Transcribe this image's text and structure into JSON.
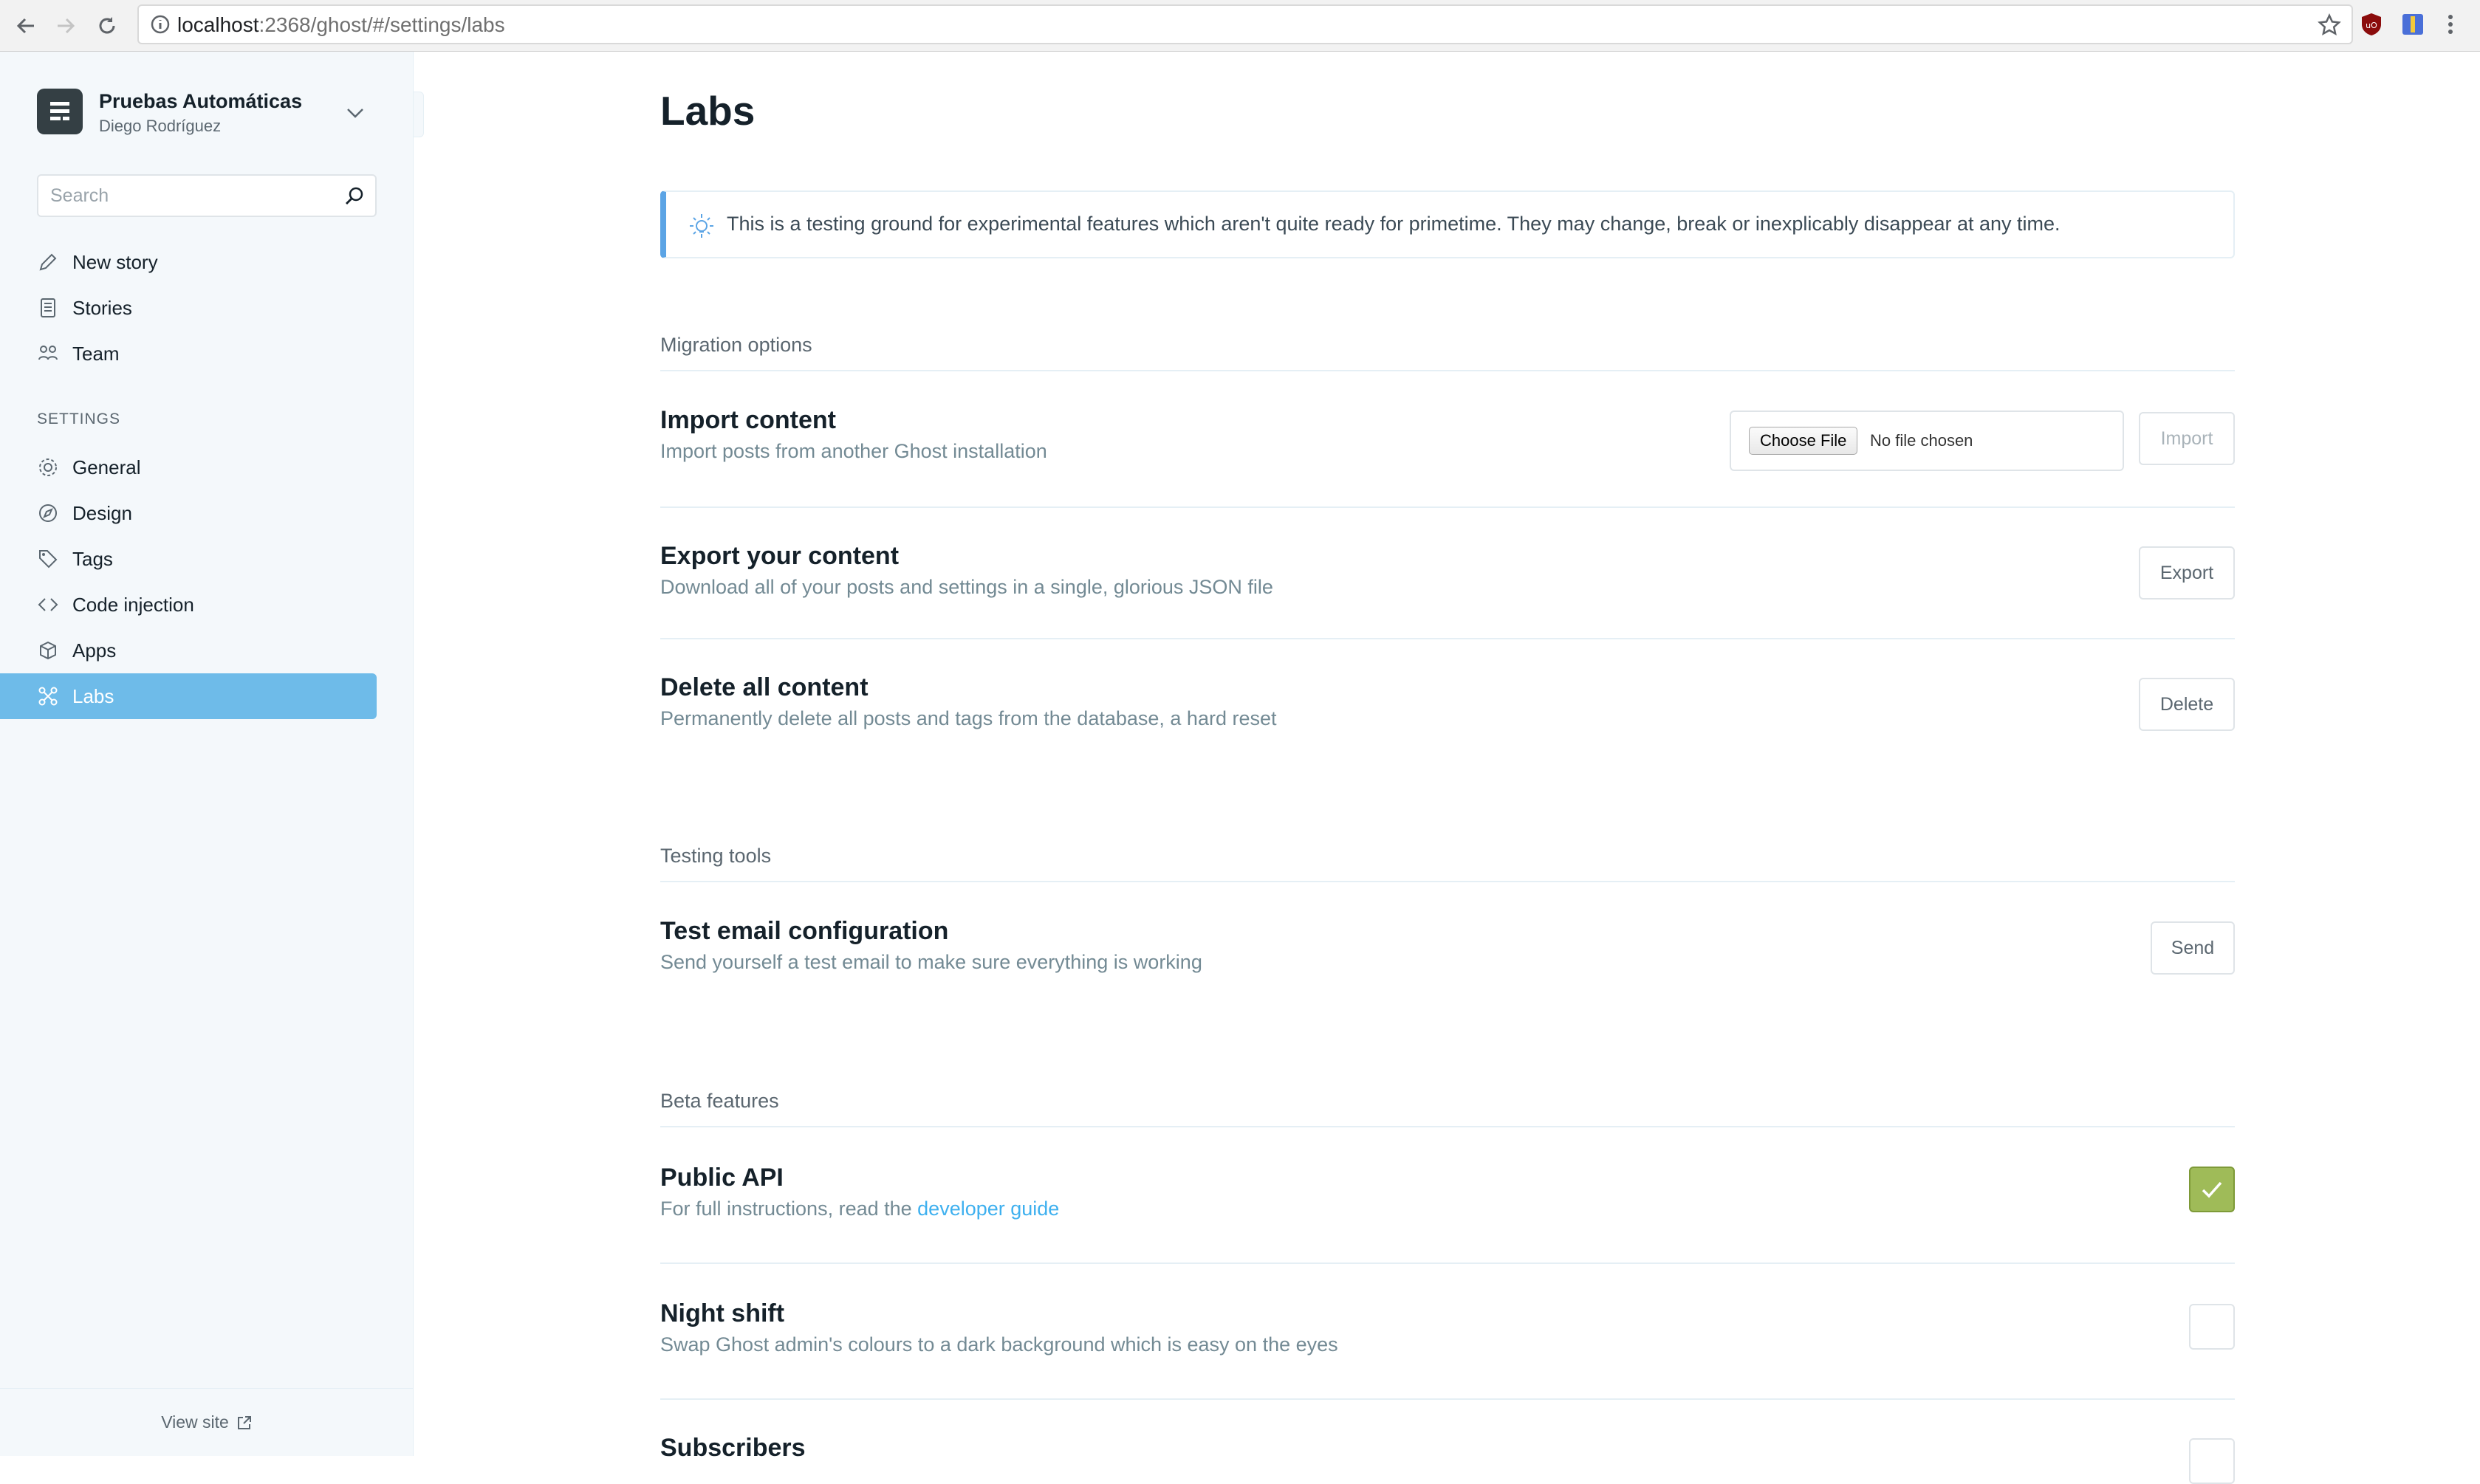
{
  "browser": {
    "url_host": "localhost",
    "url_path": ":2368/ghost/#/settings/labs"
  },
  "sidebar": {
    "blog_title": "Pruebas Automáticas",
    "user_name": "Diego Rodríguez",
    "search_placeholder": "Search",
    "nav": [
      {
        "label": "New story",
        "icon": "pencil-icon"
      },
      {
        "label": "Stories",
        "icon": "document-icon"
      },
      {
        "label": "Team",
        "icon": "team-icon"
      }
    ],
    "settings_heading": "SETTINGS",
    "settings": [
      {
        "label": "General",
        "icon": "gear-icon"
      },
      {
        "label": "Design",
        "icon": "compass-icon"
      },
      {
        "label": "Tags",
        "icon": "tag-icon"
      },
      {
        "label": "Code injection",
        "icon": "code-icon"
      },
      {
        "label": "Apps",
        "icon": "box-icon"
      },
      {
        "label": "Labs",
        "icon": "labs-icon",
        "active": true
      }
    ],
    "view_site": "View site",
    "active_color": "#6ebbe9"
  },
  "main": {
    "title": "Labs",
    "notice": "This is a testing ground for experimental features which aren't quite ready for primetime. They may change, break or inexplicably disappear at any time.",
    "sections": {
      "migration": {
        "heading": "Migration options",
        "import": {
          "title": "Import content",
          "desc": "Import posts from another Ghost installation",
          "choose_file": "Choose File",
          "file_status": "No file chosen",
          "button": "Import"
        },
        "export": {
          "title": "Export your content",
          "desc": "Download all of your posts and settings in a single, glorious JSON file",
          "button": "Export"
        },
        "delete": {
          "title": "Delete all content",
          "desc": "Permanently delete all posts and tags from the database, a hard reset",
          "button": "Delete"
        }
      },
      "testing": {
        "heading": "Testing tools",
        "email": {
          "title": "Test email configuration",
          "desc": "Send yourself a test email to make sure everything is working",
          "button": "Send"
        }
      },
      "beta": {
        "heading": "Beta features",
        "public_api": {
          "title": "Public API",
          "desc_prefix": "For full instructions, read the ",
          "link": "developer guide",
          "checked": true
        },
        "night_shift": {
          "title": "Night shift",
          "desc": "Swap Ghost admin's colours to a dark background which is easy on the eyes",
          "checked": false
        },
        "subscribers": {
          "title": "Subscribers",
          "checked": false
        }
      }
    },
    "accent_color": "#3eb0ef",
    "check_color": "#9fbb58"
  }
}
